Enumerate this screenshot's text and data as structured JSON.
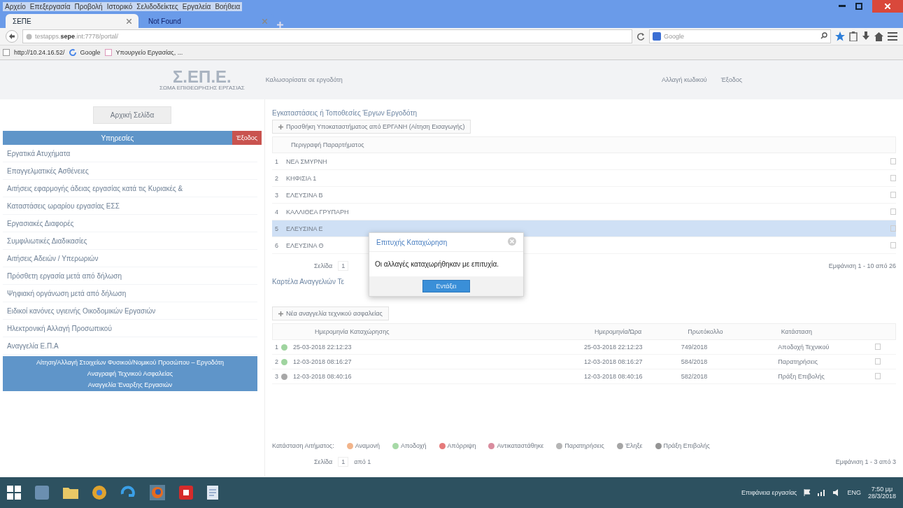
{
  "browser": {
    "menu": [
      "Αρχείο",
      "Επεξεργασία",
      "Προβολή",
      "Ιστορικό",
      "Σελιδοδείκτες",
      "Εργαλεία",
      "Βοήθεια"
    ],
    "tabs": [
      {
        "label": "ΣΕΠΕ",
        "selected": true
      },
      {
        "label": "Not Found",
        "selected": false
      }
    ],
    "url_host": "testapps.sepe.int",
    "url_path": ":7778/portal/",
    "search_placeholder": "Google",
    "bookmarks": [
      "http://10.24.16.52/",
      "Google",
      "Υπουργείο Εργασίας, ..."
    ]
  },
  "page": {
    "header": {
      "logo": "Σ.ΕΠ.Ε.",
      "logo_subtitle": "ΣΩΜΑ ΕΠΙΘΕΩΡΗΣΗΣ ΕΡΓΑΣΙΑΣ",
      "welcome": "Καλωσορίσατε σε εργοδότη",
      "links": [
        "Αλλαγή κωδικού",
        "Έξοδος"
      ]
    },
    "sidebar": {
      "home_button": "Αρχική Σελίδα",
      "section_title": "Υπηρεσίες",
      "section_badge": "Έξοδος",
      "items": [
        "Εργατικά Ατυχήματα",
        "Επαγγελματικές Ασθένειες",
        "Αιτήσεις εφαρμογής άδειας εργασίας κατά τις Κυριακές &",
        "Καταστάσεις ωραρίου εργασίας ΕΣΣ",
        "Εργασιακές Διαφορές",
        "Συμφιλιωτικές Διαδικασίες",
        "Αιτήσεις Αδειών / Υπερωριών",
        "Πρόσθετη εργασία μετά από δήλωση",
        "Ψηφιακή οργάνωση μετά από δήλωση",
        "Ειδικοί κανόνες υγιεινής Οικοδομικών Εργασιών",
        "Ηλεκτρονική Αλλαγή Προσωπικού",
        "Αναγγελία Ε.Π.Α"
      ],
      "panel_items": [
        "Αίτηση/Αλλαγή Στοιχείων Φυσικού/Νομικού Προσώπου – Εργοδότη",
        "Αναγραφή Τεχνικού Ασφαλείας",
        "Αναγγελία Έναρξης Εργασιών"
      ]
    },
    "branches": {
      "title": "Εγκαταστάσεις ή Τοποθεσίες Έργων Εργοδότη",
      "add_button": "Προσθήκη Υποκαταστήματος από ΕΡΓΑΝΗ (Αίτηση Εισαγωγής)",
      "column": "Περιγραφή Παραρτήματος",
      "rows": [
        {
          "number": "1",
          "name": "ΝΕΑ ΣΜΥΡΝΗ",
          "selected": false
        },
        {
          "number": "2",
          "name": "ΚΗΦΙΣΙΑ 1",
          "selected": false
        },
        {
          "number": "3",
          "name": "ΕΛΕΥΣΙΝΑ Β",
          "selected": false
        },
        {
          "number": "4",
          "name": "ΚΑΛΛΙΘΕΑ ΓΡΥΠΑΡΗ",
          "selected": false
        },
        {
          "number": "5",
          "name": "ΕΛΕΥΣΙΝΑ Ε",
          "selected": true
        },
        {
          "number": "6",
          "name": "ΕΛΕΥΣΙΝΑ Θ",
          "selected": false
        }
      ],
      "page_label": "Σελίδα",
      "page_value": "1",
      "summary": "Εμφάνιση 1 - 10 από 26"
    },
    "announcements": {
      "title": "Καρτέλα Αναγγελιών Τε",
      "add_button": "Νέα αναγγελία τεχνικού ασφαλείας",
      "columns": [
        "Ημερομηνία Καταχώρησης",
        "Ημερομηνία/Ώρα",
        "Πρωτόκολλο",
        "Κατάσταση"
      ],
      "rows": [
        {
          "number": "1",
          "color": "#9fd49f",
          "cells": [
            "25-03-2018 22:12:23",
            "25-03-2018 22:12:23",
            "749/2018",
            "Αποδοχή Τεχνικού"
          ]
        },
        {
          "number": "2",
          "color": "#9fd49f",
          "cells": [
            "12-03-2018 08:16:27",
            "12-03-2018 08:16:27",
            "584/2018",
            "Παρατηρήσεις"
          ]
        },
        {
          "number": "3",
          "color": "#a8a8a8",
          "cells": [
            "12-03-2018 08:40:16",
            "12-03-2018 08:40:16",
            "582/2018",
            "Πράξη Επιβολής"
          ]
        }
      ],
      "legend_label": "Κατάσταση Αιτήματος:",
      "legend": [
        {
          "label": "Αναμονή",
          "color": "#f2b48a"
        },
        {
          "label": "Αποδοχή",
          "color": "#a6d9a6"
        },
        {
          "label": "Απόρριψη",
          "color": "#e57a7a"
        },
        {
          "label": "Αντικαταστάθηκε",
          "color": "#d98c9e"
        },
        {
          "label": "Παρατηρήσεις",
          "color": "#b5b5b5"
        },
        {
          "label": "Έληξε",
          "color": "#a5a5a5"
        },
        {
          "label": "Πράξη Επιβολής",
          "color": "#949494"
        }
      ],
      "page_label": "Σελίδα",
      "page_value": "1",
      "page_of": "από 1",
      "summary": "Εμφάνιση 1 - 3 από 3"
    },
    "dialog": {
      "title": "Επιτυχής Καταχώρηση",
      "message": "Οι αλλαγές καταχωρήθηκαν με επιτυχία.",
      "button": "Εντάξει"
    }
  },
  "taskbar": {
    "desktop_label": "Επιφάνεια εργασίας",
    "language": "ENG",
    "time": "7:50 μμ",
    "date": "28/3/2018"
  }
}
